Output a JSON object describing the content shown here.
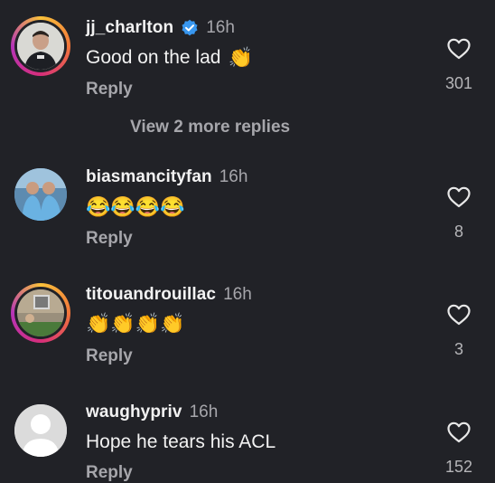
{
  "comments": [
    {
      "username": "jj_charlton",
      "verified": true,
      "time": "16h",
      "text": "Good on the lad",
      "emoji": "👏",
      "reply_label": "Reply",
      "likes": "301",
      "has_story_ring": true
    },
    {
      "username": "biasmancityfan",
      "verified": false,
      "time": "16h",
      "text": "",
      "emoji": "😂😂😂😂",
      "reply_label": "Reply",
      "likes": "8",
      "has_story_ring": false
    },
    {
      "username": "titouandrouillac",
      "verified": false,
      "time": "16h",
      "text": "",
      "emoji": "👏👏👏👏",
      "reply_label": "Reply",
      "likes": "3",
      "has_story_ring": true
    },
    {
      "username": "waughypriv",
      "verified": false,
      "time": "16h",
      "text": "Hope he tears his ACL",
      "emoji": "",
      "reply_label": "Reply",
      "likes": "152",
      "has_story_ring": false
    }
  ],
  "view_more_replies": "View 2 more replies",
  "colors": {
    "background": "#212227",
    "secondary_text": "#a6a6ab",
    "verified_blue": "#3897f0"
  },
  "icons": {
    "like": "heart-outline-icon",
    "verified": "verified-badge-icon"
  }
}
